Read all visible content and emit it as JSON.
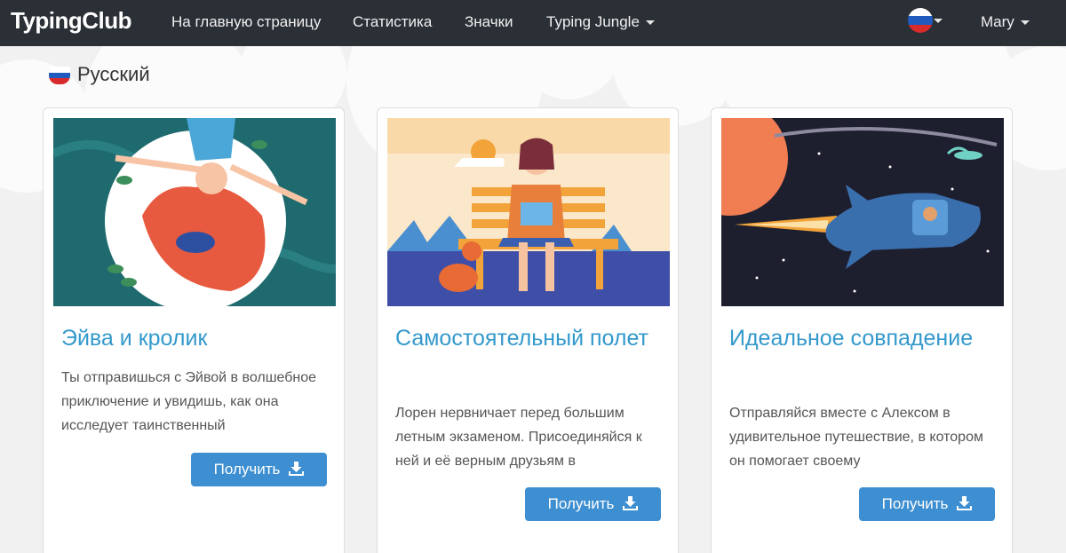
{
  "navbar": {
    "brand": "TypingClub",
    "links": [
      "На главную страницу",
      "Статистика",
      "Значки"
    ],
    "dropdown_label": "Typing Jungle",
    "user_name": "Mary"
  },
  "section": {
    "language": "Русский"
  },
  "cards": [
    {
      "title": "Эйва и кролик",
      "description": "Ты отправишься с Эйвой в волшебное приключение и увидишь, как она исследует таинственный",
      "button": "Получить"
    },
    {
      "title": "Самостоятельный полет",
      "description": "Лорен нервничает перед большим летным экзаменом. Присоединяйся к ней и её верным друзьям в",
      "button": "Получить"
    },
    {
      "title": "Идеальное совпадение",
      "description": "Отправляйся вместе с Алексом в удивительное путешествие, в котором он помогает своему",
      "button": "Получить"
    }
  ],
  "colors": {
    "navbar": "#2b2f36",
    "accent": "#3399cc",
    "button": "#3d8fd1"
  }
}
